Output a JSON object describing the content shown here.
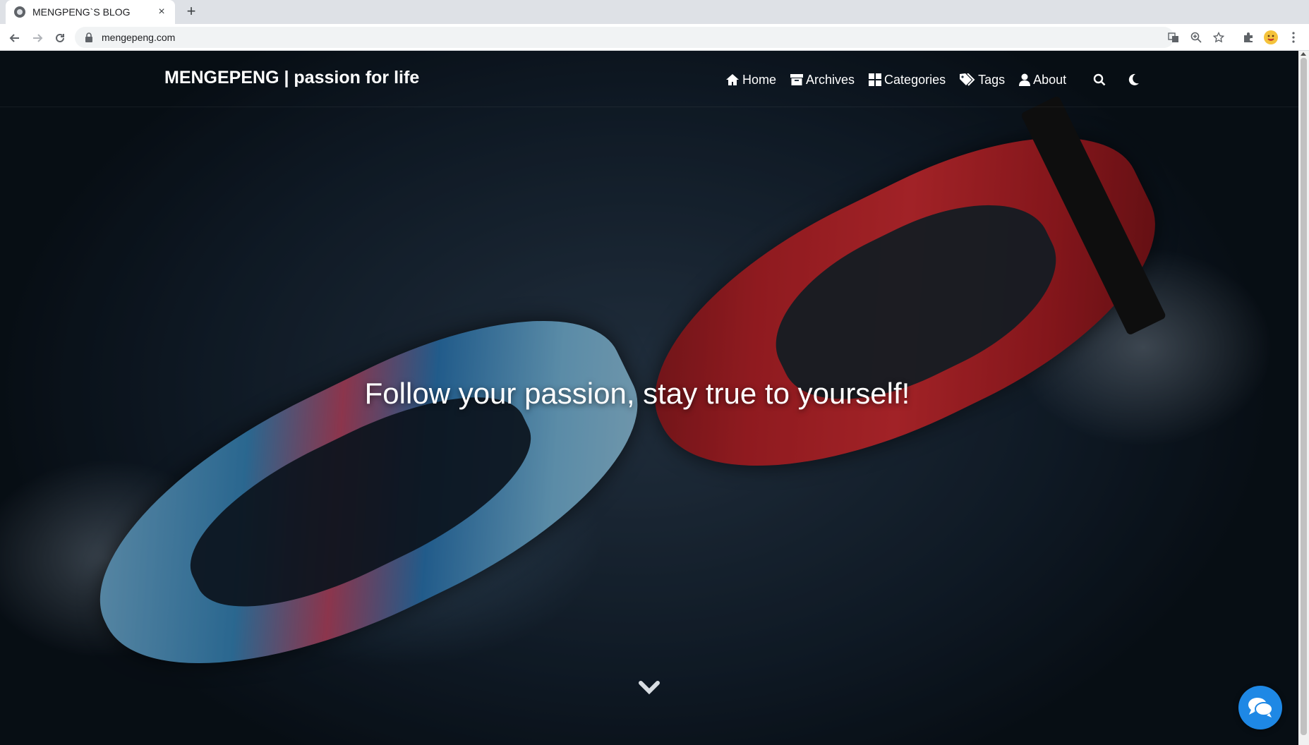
{
  "browser": {
    "tab_title": "MENGPENG`S BLOG",
    "new_tab_symbol": "+",
    "close_symbol": "×",
    "url": "mengepeng.com"
  },
  "site": {
    "brand": "MENGEPENG | passion for life",
    "menu": [
      {
        "label": "Home",
        "icon": "home-icon"
      },
      {
        "label": "Archives",
        "icon": "archive-icon"
      },
      {
        "label": "Categories",
        "icon": "categories-icon"
      },
      {
        "label": "Tags",
        "icon": "tags-icon"
      },
      {
        "label": "About",
        "icon": "user-icon"
      }
    ],
    "headline": "Follow your passion, stay true to yourself!"
  },
  "colors": {
    "chat_button": "#1e88e5",
    "nav_text": "#ffffff"
  }
}
